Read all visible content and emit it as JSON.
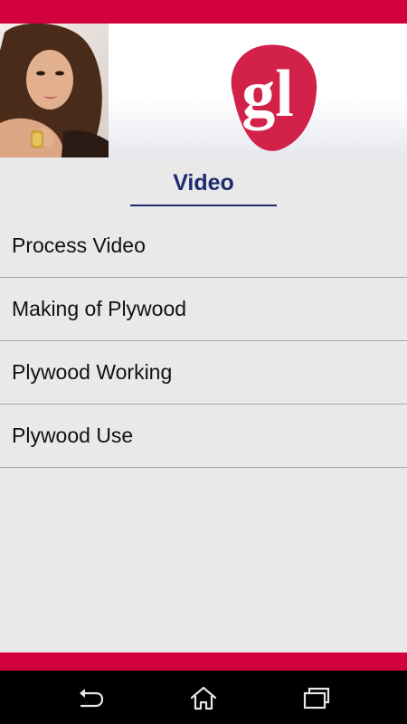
{
  "banner": {
    "logo_text": "gl"
  },
  "page": {
    "title": "Video"
  },
  "menu": {
    "items": [
      {
        "label": "Process Video"
      },
      {
        "label": "Making of Plywood"
      },
      {
        "label": "Plywood Working"
      },
      {
        "label": "Plywood Use"
      }
    ]
  },
  "colors": {
    "brand_red": "#d2003d",
    "title_blue": "#1c2a6e",
    "background": "#e9e9e9"
  },
  "navbar": {
    "icons": [
      "back-icon",
      "home-icon",
      "recent-apps-icon"
    ]
  }
}
